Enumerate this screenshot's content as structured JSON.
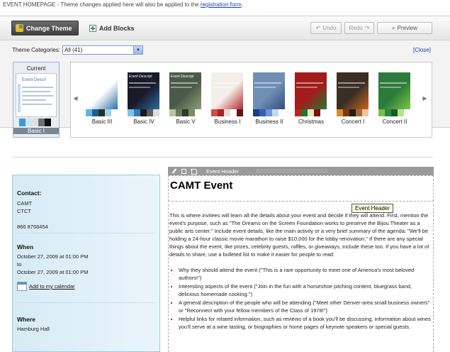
{
  "notice": {
    "prefix": "EVENT HOMEPAGE - Theme changes applied here will also be applied to the ",
    "link": "registration form",
    "suffix": "."
  },
  "toolbar": {
    "change_theme": "Change Theme",
    "add_blocks": "Add Blocks",
    "undo": "Undo",
    "redo": "Redo",
    "preview": "Preview"
  },
  "theme_categories": {
    "label": "Theme Categories:",
    "selected": "All (41)",
    "close": "[Close]"
  },
  "current_theme": {
    "label": "Current",
    "thumb_title": "Event Descri",
    "name": "Basic I",
    "swatches": [
      "#3b9bd8",
      "#cfe6f6",
      "#e0e0e0",
      "#6f6f6f",
      "#111111"
    ]
  },
  "themes": [
    {
      "name": "Basic III",
      "title": "",
      "bg": "#ffffff",
      "accent": "#2b6ea8",
      "swatches": [
        "#5fb7e0",
        "#1f5f90",
        "#2c2c2c",
        "#9cd2ea",
        "#ffffff"
      ]
    },
    {
      "name": "Basic IV",
      "title": "Event Descript",
      "bg": "#1a1a2a",
      "accent": "#2d6ea0",
      "swatches": [
        "#7dc4e8",
        "#3a7ab0",
        "#1a1a1a",
        "#5e5e5e",
        "#dfdfdf"
      ]
    },
    {
      "name": "Basic V",
      "title": "Event Descript",
      "bg": "#4a5a48",
      "accent": "#8aa07a",
      "swatches": [
        "#b8c5a4",
        "#69795f",
        "#30372c",
        "#7a8b6c",
        "#ffffff"
      ]
    },
    {
      "name": "Business I",
      "title": "",
      "bg": "#f4eeea",
      "accent": "#b22a2a",
      "swatches": [
        "#d94a4a",
        "#a32424",
        "#eadbd3",
        "#ffffff",
        "#5c1616"
      ]
    },
    {
      "name": "Business II",
      "title": "",
      "bg": "#6f8fb5",
      "accent": "#2f4f7a",
      "swatches": [
        "#1a3f86",
        "#2f62b4",
        "#6f95d6",
        "#c9d8f0",
        "#ffffff"
      ]
    },
    {
      "name": "Christmas",
      "title": "",
      "bg": "#a31b1b",
      "accent": "#23782f",
      "swatches": [
        "#c61d1d",
        "#1d7a2c",
        "#f2e2c4",
        "#7a1010",
        "#ffffff"
      ]
    },
    {
      "name": "Concert I",
      "title": "",
      "bg": "#3b2e25",
      "accent": "#c8661e",
      "swatches": [
        "#d98c2a",
        "#7a3b10",
        "#2a1d14",
        "#a06a3a",
        "#eac7a0"
      ]
    },
    {
      "name": "Concert II",
      "title": "",
      "bg": "#2d7a3b",
      "accent": "#7ac943",
      "swatches": [
        "#77c043",
        "#2d8a3b",
        "#195a25",
        "#b9e28f",
        "#ffffff"
      ]
    }
  ],
  "event_header": {
    "bar_label": "Event Header",
    "title": "CAMT Event",
    "tooltip": "Event Header"
  },
  "sidebar": {
    "contact": {
      "title": "Contact:",
      "lines": [
        "CAMT",
        "CTCT",
        "",
        "866 8768454"
      ]
    },
    "when": {
      "title": "When",
      "lines": [
        "October 27, 2009 at 01:00 PM",
        "to",
        "October 27, 2009 at 01:00 PM"
      ],
      "calendar_link": "Add to my calendar"
    },
    "where": {
      "title": "Where",
      "lines": [
        "Hamburg Hall"
      ]
    }
  },
  "body": {
    "paragraph": "This is where invitees will learn all the details about your event and decide if they will attend. First, mention the event's purpose, such as \"The Dreams on the Screen Foundation works to preserve the Bijou Theater as a public arts center.\" Include event details, like the main activity or a very brief summary of the agenda: \"We'll be holding a 24-hour classic movie marathon to raise $10,000 for the lobby renovation.\" If there are any special things about the event, like prizes, celebrity guests, raffles, or giveaways, include these too. If you have a lot of details to share, use a bulleted list to make it easier for people to read:",
    "bullets": [
      "Why they should attend the event (\"This is a rare opportunity to meet one of America's most beloved authors!\")",
      "Interesting aspects of the event (\"Join in the fun with a horseshoe pitching content, bluegrass band, delicious homemade cooking.\")",
      "A general description of the people who will be attending (\"Meet other Denver-area small business owners\" or \"Reconnect with your fellow members of the Class of 1978!\")",
      "Helpful links for related information, such as reviews of a book you'll be discussing, information about wines you'll serve at a wine tasting, or biographies or home pages of keynote speakers or special guests."
    ]
  }
}
